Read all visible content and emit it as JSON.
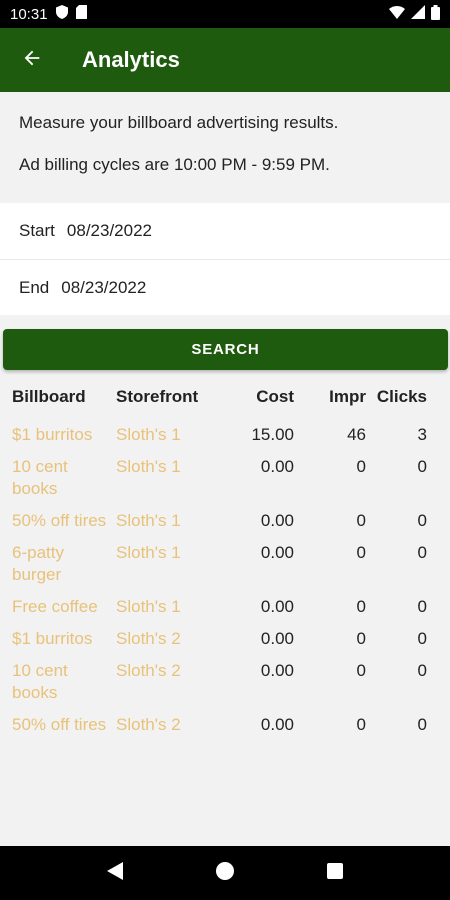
{
  "status": {
    "time": "10:31"
  },
  "header": {
    "title": "Analytics",
    "back_icon": "arrow-left-icon"
  },
  "description": {
    "line1": "Measure your billboard advertising results.",
    "line2": "Ad billing cycles are 10:00 PM - 9:59 PM."
  },
  "filters": {
    "start_label": "Start",
    "start_value": "08/23/2022",
    "end_label": "End",
    "end_value": "08/23/2022"
  },
  "search_label": "SEARCH",
  "table": {
    "headers": [
      "Billboard",
      "Storefront",
      "Cost",
      "Impr",
      "Clicks"
    ],
    "rows": [
      {
        "billboard": "$1 burritos",
        "storefront": "Sloth's 1",
        "cost": "15.00",
        "impr": "46",
        "clicks": "3"
      },
      {
        "billboard": "10 cent books",
        "storefront": "Sloth's 1",
        "cost": "0.00",
        "impr": "0",
        "clicks": "0"
      },
      {
        "billboard": "50% off tires",
        "storefront": "Sloth's 1",
        "cost": "0.00",
        "impr": "0",
        "clicks": "0"
      },
      {
        "billboard": "6-patty burger",
        "storefront": "Sloth's 1",
        "cost": "0.00",
        "impr": "0",
        "clicks": "0"
      },
      {
        "billboard": "Free coffee",
        "storefront": "Sloth's 1",
        "cost": "0.00",
        "impr": "0",
        "clicks": "0"
      },
      {
        "billboard": "$1 burritos",
        "storefront": "Sloth's 2",
        "cost": "0.00",
        "impr": "0",
        "clicks": "0"
      },
      {
        "billboard": "10 cent books",
        "storefront": "Sloth's 2",
        "cost": "0.00",
        "impr": "0",
        "clicks": "0"
      },
      {
        "billboard": "50% off tires",
        "storefront": "Sloth's 2",
        "cost": "0.00",
        "impr": "0",
        "clicks": "0"
      }
    ]
  },
  "colors": {
    "primary": "#1e5b0e",
    "link": "#e8c27a"
  }
}
